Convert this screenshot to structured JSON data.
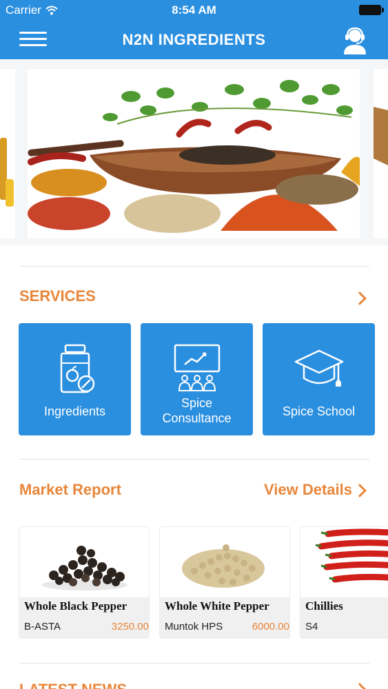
{
  "status_bar": {
    "carrier": "Carrier",
    "time": "8:54 AM"
  },
  "header": {
    "title": "N2N INGREDIENTS"
  },
  "services": {
    "title": "SERVICES",
    "items": [
      {
        "label": "Ingredients",
        "icon": "jar-icon"
      },
      {
        "label": "Spice Consultance",
        "icon": "presentation-icon"
      },
      {
        "label": "Spice School",
        "icon": "graduation-cap-icon"
      }
    ]
  },
  "market_report": {
    "title": "Market Report",
    "view_details": "View Details",
    "products": [
      {
        "name": "Whole Black Pepper",
        "grade": "B-ASTA",
        "price": "3250.00"
      },
      {
        "name": "Whole White Pepper",
        "grade": "Muntok HPS",
        "price": "6000.00"
      },
      {
        "name": "Chillies",
        "grade": "S4",
        "price": ""
      }
    ]
  },
  "latest_news": {
    "title": "LATEST NEWS"
  },
  "colors": {
    "primary": "#2b8fe0",
    "accent": "#e8863a"
  }
}
